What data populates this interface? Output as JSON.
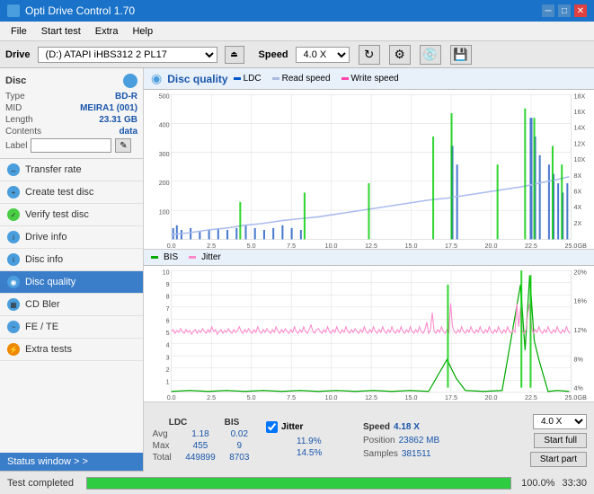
{
  "app": {
    "title": "Opti Drive Control 1.70",
    "titlebar_controls": [
      "minimize",
      "maximize",
      "close"
    ]
  },
  "menu": {
    "items": [
      "File",
      "Start test",
      "Extra",
      "Help"
    ]
  },
  "drive": {
    "label": "Drive",
    "drive_value": "(D:) ATAPI iHBS312 2 PL17",
    "speed_label": "Speed",
    "speed_value": "4.0 X"
  },
  "disc": {
    "title": "Disc",
    "type_label": "Type",
    "type_value": "BD-R",
    "mid_label": "MID",
    "mid_value": "MEIRA1 (001)",
    "length_label": "Length",
    "length_value": "23.31 GB",
    "contents_label": "Contents",
    "contents_value": "data",
    "label_label": "Label",
    "label_value": ""
  },
  "nav": {
    "items": [
      {
        "id": "transfer-rate",
        "label": "Transfer rate",
        "icon": "blue"
      },
      {
        "id": "create-test-disc",
        "label": "Create test disc",
        "icon": "blue"
      },
      {
        "id": "verify-test-disc",
        "label": "Verify test disc",
        "icon": "blue"
      },
      {
        "id": "drive-info",
        "label": "Drive info",
        "icon": "blue"
      },
      {
        "id": "disc-info",
        "label": "Disc info",
        "icon": "blue"
      },
      {
        "id": "disc-quality",
        "label": "Disc quality",
        "icon": "blue",
        "active": true
      },
      {
        "id": "cd-bler",
        "label": "CD Bler",
        "icon": "blue"
      },
      {
        "id": "fe-te",
        "label": "FE / TE",
        "icon": "blue"
      },
      {
        "id": "extra-tests",
        "label": "Extra tests",
        "icon": "blue"
      }
    ]
  },
  "status_window": "Status window > >",
  "content": {
    "title": "Disc quality",
    "legend_ldc": "LDC",
    "legend_read": "Read speed",
    "legend_write": "Write speed",
    "legend_bis": "BIS",
    "legend_jitter": "Jitter"
  },
  "chart_upper": {
    "y_max": 500,
    "y_labels": [
      "500",
      "400",
      "300",
      "200",
      "100"
    ],
    "x_labels": [
      "0.0",
      "2.5",
      "5.0",
      "7.5",
      "10.0",
      "12.5",
      "15.0",
      "17.5",
      "20.0",
      "22.5",
      "25.0"
    ],
    "right_labels": [
      "18X",
      "16X",
      "14X",
      "12X",
      "10X",
      "8X",
      "6X",
      "4X",
      "2X"
    ],
    "unit": "GB"
  },
  "chart_lower": {
    "y_labels": [
      "10",
      "9",
      "8",
      "7",
      "6",
      "5",
      "4",
      "3",
      "2",
      "1"
    ],
    "x_labels": [
      "0.0",
      "2.5",
      "5.0",
      "7.5",
      "10.0",
      "12.5",
      "15.0",
      "17.5",
      "20.0",
      "22.5",
      "25.0"
    ],
    "right_labels": [
      "20%",
      "16%",
      "12%",
      "8%",
      "4%"
    ],
    "unit": "GB"
  },
  "stats": {
    "ldc_label": "LDC",
    "bis_label": "BIS",
    "jitter_label": "Jitter",
    "speed_label": "Speed",
    "speed_val": "4.18 X",
    "speed_select": "4.0 X",
    "avg_label": "Avg",
    "avg_ldc": "1.18",
    "avg_bis": "0.02",
    "avg_jitter": "11.9%",
    "max_label": "Max",
    "max_ldc": "455",
    "max_bis": "9",
    "max_jitter": "14.5%",
    "total_label": "Total",
    "total_ldc": "449899",
    "total_bis": "8703",
    "position_label": "Position",
    "position_val": "23862 MB",
    "samples_label": "Samples",
    "samples_val": "381511",
    "start_full_label": "Start full",
    "start_part_label": "Start part"
  },
  "bottom": {
    "status_text": "Test completed",
    "progress": 100,
    "progress_label": "100.0%",
    "time_label": "33:30"
  }
}
